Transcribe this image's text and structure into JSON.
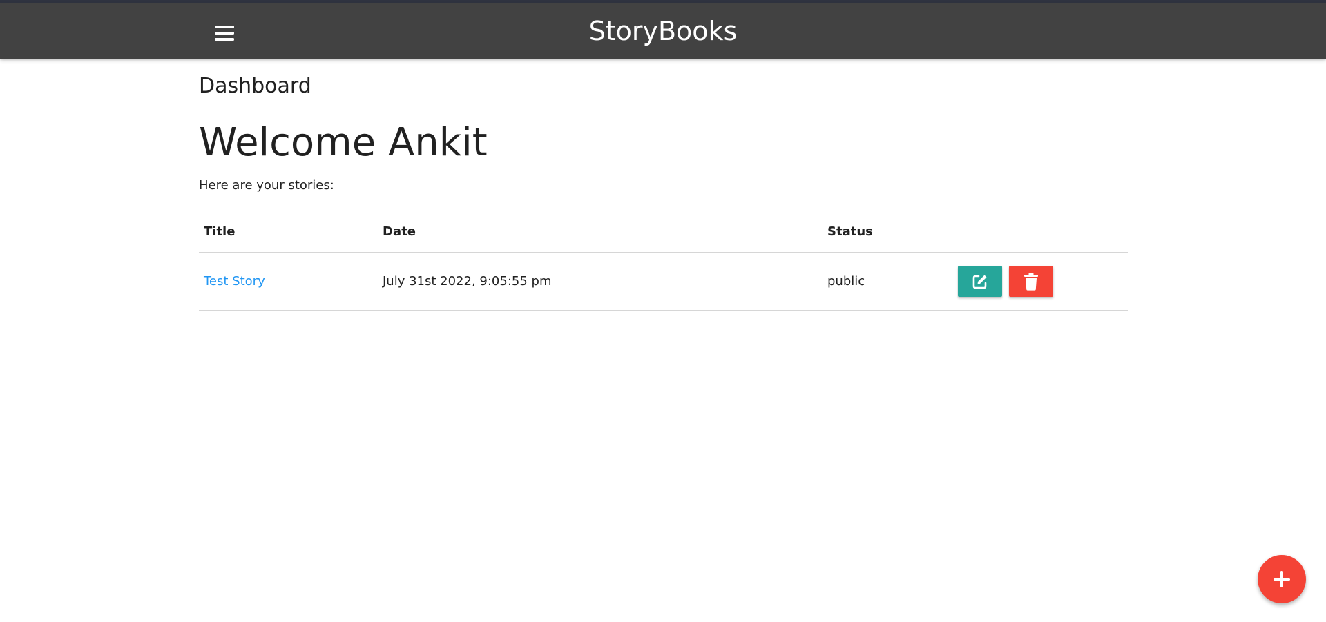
{
  "navbar": {
    "brand": "StoryBooks",
    "menu_icon": "hamburger-menu-icon",
    "background": "#424242"
  },
  "page": {
    "heading": "Dashboard",
    "welcome": "Welcome Ankit",
    "intro": "Here are your stories:"
  },
  "table": {
    "headers": {
      "title": "Title",
      "date": "Date",
      "status": "Status"
    },
    "rows": [
      {
        "title": "Test Story",
        "date": "July 31st 2022, 9:05:55 pm",
        "status": "public",
        "edit_icon": "edit-icon",
        "delete_icon": "trash-icon"
      }
    ]
  },
  "fab": {
    "icon": "plus-icon",
    "color": "#f44336"
  },
  "colors": {
    "link": "#2196f3",
    "edit_button": "#26a69a",
    "delete_button": "#f44336"
  }
}
